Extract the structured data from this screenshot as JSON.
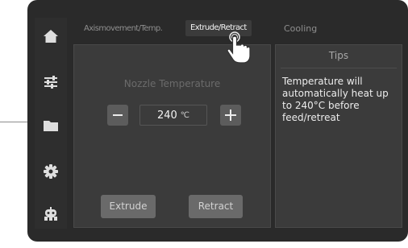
{
  "sidebar": {
    "items": [
      {
        "icon": "home-icon"
      },
      {
        "icon": "sliders-icon"
      },
      {
        "icon": "folder-icon"
      },
      {
        "icon": "gear-icon"
      },
      {
        "icon": "robot-icon"
      }
    ]
  },
  "tabs": [
    {
      "label": "Axismovement/Temp."
    },
    {
      "label": "Extrude/Retract"
    },
    {
      "label": "Cooling"
    }
  ],
  "active_tab": "Extrude/Retract",
  "nozzle": {
    "label": "Nozzle Temperature",
    "decrease_label": "−",
    "increase_label": "+",
    "value": "240",
    "unit": "℃"
  },
  "actions": {
    "extrude_label": "Extrude",
    "retract_label": "Retract"
  },
  "tips": {
    "title": "Tips",
    "body": "Temperature will automatically heat up to 240°C before feed/retreat"
  },
  "colors": {
    "bezel": "#2a2a2a",
    "sidebar": "#2e2e2e",
    "panel": "#3b3b3b",
    "button": "#5c5c5c",
    "action_button": "#6a6a6a",
    "text_light": "#f2f2f2",
    "text_muted": "#8e8e8e"
  }
}
